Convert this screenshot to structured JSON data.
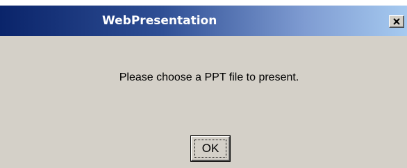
{
  "dialog": {
    "title": "WebPresentation",
    "message": "Please choose a PPT file to present.",
    "ok_label": "OK",
    "close_icon": "close-icon"
  },
  "colors": {
    "titlebar_start": "#0a246a",
    "titlebar_end": "#a6caf0",
    "dialog_background": "#d4d0c8",
    "title_text": "#ffffff"
  }
}
